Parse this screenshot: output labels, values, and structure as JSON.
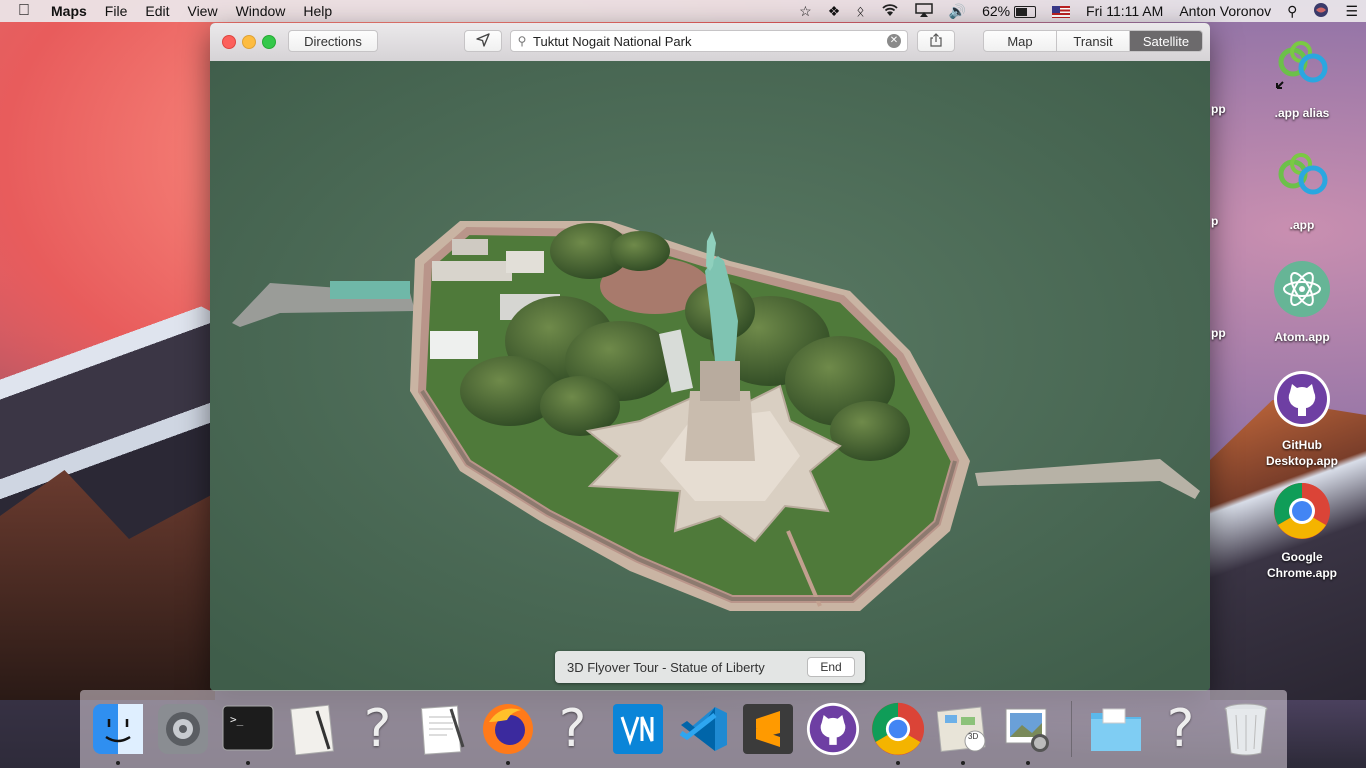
{
  "menubar": {
    "app": "Maps",
    "menus": [
      "File",
      "Edit",
      "View",
      "Window",
      "Help"
    ],
    "battery": "62%",
    "clock": "Fri 11:11 AM",
    "user": "Anton Voronov"
  },
  "window": {
    "directions_label": "Directions",
    "search_value": "Tuktut Nogait National Park",
    "map_modes": [
      "Map",
      "Transit",
      "Satellite"
    ],
    "active_mode": "Satellite",
    "flyover": {
      "label": "3D Flyover Tour - Statue of Liberty",
      "end_label": "End"
    }
  },
  "desktop": {
    "icons": [
      {
        "label": ".app alias",
        "icon": "app-alias-icon"
      },
      {
        "label": ".app",
        "icon": "app-icon"
      },
      {
        "label": "Atom.app",
        "icon": "atom-icon"
      },
      {
        "label": "GitHub Desktop.app",
        "icon": "github-icon"
      },
      {
        "label": "Google Chrome.app",
        "icon": "chrome-icon"
      }
    ],
    "clipped_labels": [
      "pp",
      "p",
      "pp"
    ]
  },
  "dock": {
    "items": [
      "finder",
      "system-preferences",
      "terminal",
      "script-editor",
      "unknown",
      "textedit",
      "firefox",
      "unknown",
      "vnc-viewer",
      "vscode",
      "sublime-text",
      "github-desktop",
      "chrome",
      "maps",
      "preview",
      "downloads-folder",
      "unknown",
      "trash"
    ],
    "terminal_prompt": ">_",
    "maps_badge": "3D"
  },
  "colors": {
    "segment_active": "#6c6a6c",
    "atom": "#66b596",
    "github": "#6e3fa3"
  }
}
